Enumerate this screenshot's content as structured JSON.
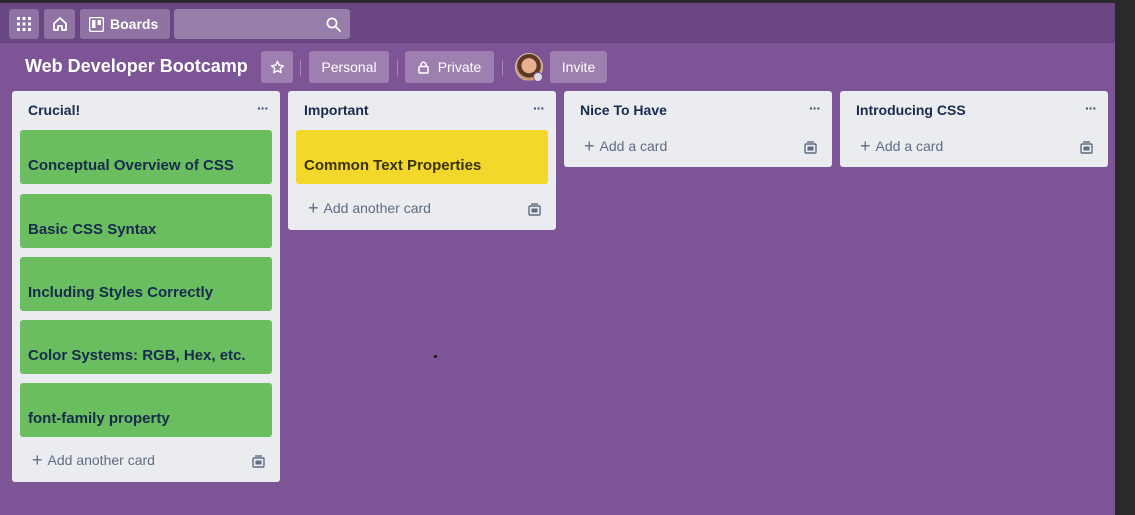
{
  "header": {
    "boards_label": "Boards",
    "icons": [
      "apps-grid-icon",
      "home-icon",
      "boards-icon",
      "search-icon"
    ]
  },
  "board": {
    "title": "Web Developer Bootcamp",
    "personal_label": "Personal",
    "private_label": "Private",
    "invite_label": "Invite",
    "background_color": "#7d5596"
  },
  "lists": [
    {
      "title": "Crucial!",
      "menu": "···",
      "cards": [
        "Conceptual Overview of CSS",
        "Basic CSS Syntax",
        "Including Styles Correctly",
        "Color Systems: RGB, Hex, etc.",
        "font-family property"
      ],
      "add_label": "Add another card"
    },
    {
      "title": "Important",
      "menu": "···",
      "cards": [
        "Common Text Properties"
      ],
      "add_label": "Add another card"
    },
    {
      "title": "Nice To Have",
      "menu": "···",
      "cards": [],
      "add_label": "Add a card"
    },
    {
      "title": "Introducing CSS",
      "menu": "···",
      "cards": [],
      "add_label": "Add a card"
    }
  ],
  "colors": {
    "green_label": "#6abe5f",
    "yellow_label": "#f3d72a",
    "list_bg": "#ebecf0"
  }
}
